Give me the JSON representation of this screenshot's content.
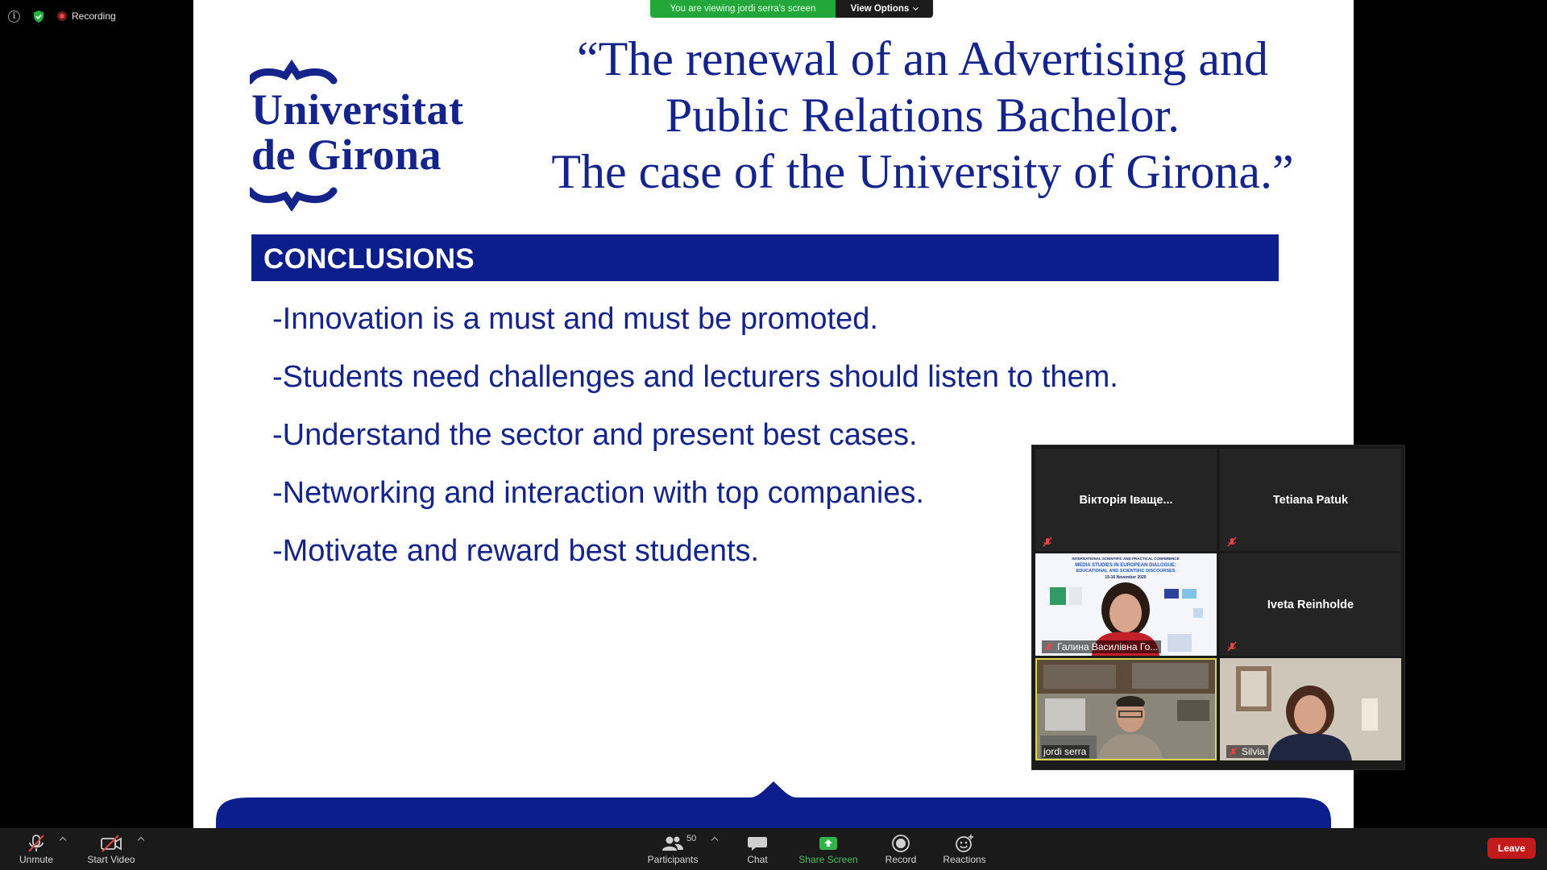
{
  "status": {
    "recording_label": "Recording"
  },
  "share_banner": {
    "viewing_text": "You are viewing jordi serra's screen",
    "options_label": "View Options"
  },
  "slide": {
    "logo_line1": "Universitat",
    "logo_line2": "de Girona",
    "title_lines": [
      "“The renewal of an Advertising and",
      "Public Relations Bachelor.",
      "The case of the University of Girona.”"
    ],
    "section_heading": "CONCLUSIONS",
    "bullets": [
      "-Innovation is a must and must be promoted.",
      "-Students need challenges and lecturers should listen to them.",
      "-Understand the sector and present best cases.",
      "-Networking and interaction with top companies.",
      "-Motivate and reward best students."
    ],
    "colors": {
      "brand_blue": "#14248b",
      "bar_blue": "#0b1e8c"
    }
  },
  "gallery": {
    "participants": [
      {
        "name": "Вікторія Іваще...",
        "video": false,
        "muted": true
      },
      {
        "name": "Tetiana Patuk",
        "video": false,
        "muted": true
      },
      {
        "name": "Галина Василівна Го...",
        "video": true,
        "muted": true
      },
      {
        "name": "Iveta Reinholde",
        "video": false,
        "muted": true
      },
      {
        "name": "jordi serra",
        "video": true,
        "muted": false,
        "active_speaker": true
      },
      {
        "name": "Silvia",
        "video": true,
        "muted": true
      }
    ],
    "poster_text": {
      "line1": "INTERNATIONAL SCIENTIFIC AND PRACTICAL CONFERENCE",
      "line2": "MEDIA STUDIES IN EUROPEAN DIALOGUE:",
      "line3": "EDUCATIONAL AND SCIENTIFIC DISCOURSES",
      "line4": "15-16 November 2020"
    }
  },
  "toolbar": {
    "unmute_label": "Unmute",
    "start_video_label": "Start Video",
    "participants_label": "Participants",
    "participants_count": "50",
    "chat_label": "Chat",
    "share_screen_label": "Share Screen",
    "record_label": "Record",
    "reactions_label": "Reactions",
    "leave_label": "Leave"
  }
}
